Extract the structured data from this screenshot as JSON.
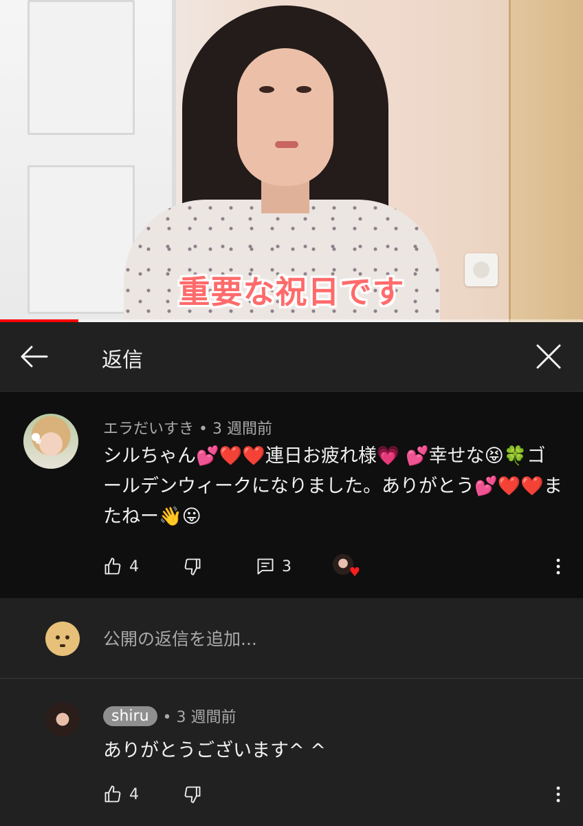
{
  "video": {
    "caption": "重要な祝日です",
    "progress": 0.135,
    "colors": {
      "progress": "#ff0000",
      "caption": "#ff6b6b"
    }
  },
  "header": {
    "title": "返信",
    "back_icon": "arrow-left-icon",
    "close_icon": "close-icon"
  },
  "parent_comment": {
    "author": "エラだいすき",
    "time": "3 週間前",
    "meta": "エラだいすき • 3 週間前",
    "text": "シルちゃん💕❤️❤️連日お疲れ様💗 💕幸せな😝🍀ゴールデンウィークになりました。ありがとう💕❤️❤️またねー👋😛",
    "likes": "4",
    "replies": "3",
    "creator_heart": true
  },
  "add_reply": {
    "placeholder": "公開の返信を追加..."
  },
  "reply": {
    "author": "shiru",
    "separator": "• 3 週間前",
    "text": "ありがとうございます^ ^",
    "likes": "4"
  }
}
